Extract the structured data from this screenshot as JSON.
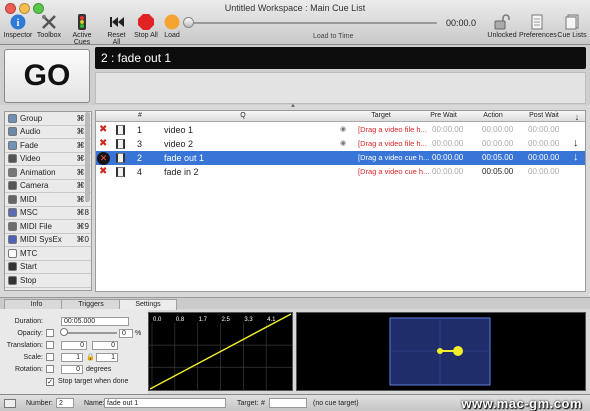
{
  "window": {
    "title": "Untitled Workspace : Main Cue List",
    "controls": [
      {
        "name": "close",
        "color": "#ee5d52"
      },
      {
        "name": "minimize",
        "color": "#f5be4f"
      },
      {
        "name": "zoom",
        "color": "#59c849"
      }
    ]
  },
  "toolbar": {
    "inspector": "Inspector",
    "toolbox": "Toolbox",
    "active_cues": "Active Cues",
    "reset_all": "Reset All",
    "stop_all": "Stop All",
    "load": "Load",
    "time": "00:00.0",
    "load_to_time": "Load to Time",
    "unlocked": "Unlocked",
    "preferences": "Preferences",
    "cue_lists": "Cue Lists"
  },
  "go": {
    "label": "GO"
  },
  "current_cue": "2 : fade out 1",
  "sidebar": {
    "items": [
      {
        "label": "Group",
        "shortcut": "⌘1",
        "icon": "group-icon",
        "color": "#6f8fb8"
      },
      {
        "label": "Audio",
        "shortcut": "⌘2",
        "icon": "audio-icon",
        "color": "#6d88a8"
      },
      {
        "label": "Fade",
        "shortcut": "⌘3",
        "icon": "fade-icon",
        "color": "#7092b9"
      },
      {
        "label": "Video",
        "shortcut": "⌘4",
        "icon": "video-icon",
        "color": "#555555"
      },
      {
        "label": "Animation",
        "shortcut": "⌘5",
        "icon": "animation-icon",
        "color": "#777777"
      },
      {
        "label": "Camera",
        "shortcut": "⌘6",
        "icon": "camera-icon",
        "color": "#555555"
      },
      {
        "label": "MIDI",
        "shortcut": "⌘7",
        "icon": "midi-icon",
        "color": "#666666"
      },
      {
        "label": "MSC",
        "shortcut": "⌘8",
        "icon": "msc-icon",
        "color": "#5b6bb0"
      },
      {
        "label": "MIDI File",
        "shortcut": "⌘9",
        "icon": "midi-file-icon",
        "color": "#6e6e6e"
      },
      {
        "label": "MIDI SysEx",
        "shortcut": "⌘0",
        "icon": "midi-sysex-icon",
        "color": "#4f63b5"
      },
      {
        "label": "MTC",
        "shortcut": "",
        "icon": "mtc-icon",
        "color": "#ffffff"
      },
      {
        "label": "Start",
        "shortcut": "",
        "icon": "start-icon",
        "color": "#333333"
      },
      {
        "label": "Stop",
        "shortcut": "",
        "icon": "stop-icon",
        "color": "#333333"
      }
    ]
  },
  "table": {
    "headers": {
      "num": "#",
      "q": "Q",
      "target": "Target",
      "pre_wait": "Pre Wait",
      "action": "Action",
      "post_wait": "Post Wait"
    },
    "rows": [
      {
        "num": "1",
        "q": "video 1",
        "target": "[Drag a video file h...",
        "pre_wait": "00:00.00",
        "action": "00:00.00",
        "post_wait": "00:00.00",
        "selected": false,
        "arrow": ""
      },
      {
        "num": "3",
        "q": "video 2",
        "target": "[Drag a video file h...",
        "pre_wait": "00:00.00",
        "action": "00:00.00",
        "post_wait": "00:00.00",
        "selected": false,
        "arrow": "↓"
      },
      {
        "num": "2",
        "q": "fade out 1",
        "target": "[Drag a video cue h...",
        "pre_wait": "00:00.00",
        "action": "00:05.00",
        "post_wait": "00:00.00",
        "selected": true,
        "arrow": "↓"
      },
      {
        "num": "4",
        "q": "fade in 2",
        "target": "[Drag a video cue h...",
        "pre_wait": "00:00.00",
        "action": "00:05.00",
        "post_wait": "00:00.00",
        "selected": false,
        "arrow": ""
      }
    ]
  },
  "tabs": {
    "info": "Info",
    "triggers": "Triggers",
    "settings": "Settings"
  },
  "settings": {
    "duration_label": "Duration:",
    "duration": "00:05.000",
    "opacity_label": "Opacity:",
    "opacity": "0",
    "percent": "%",
    "translation_label": "Translation:",
    "translation_x": "0",
    "translation_y": "0",
    "scale_label": "Scale:",
    "scale_x": "1",
    "scale_y": "1",
    "rotation_label": "Rotation:",
    "rotation": "0",
    "degrees": "degrees",
    "stop_target": "Stop target when done",
    "stop_target_checked": true
  },
  "fade_curve": {
    "ticks": [
      "0.0",
      "0.8",
      "1.7",
      "2.5",
      "3.3",
      "4.1"
    ]
  },
  "statusbar": {
    "number_label": "Number:",
    "number": "2",
    "name_label": "Name:",
    "name": "fade out 1",
    "target_label": "Target:",
    "target_hash": "#",
    "no_target": "(no cue target)"
  },
  "watermark": "www.mac-gm.com",
  "colors": {
    "selection": "#3875d7",
    "target_text": "#d8272a",
    "curve": "#f3ee28",
    "preview_box": "#1f2d6b"
  }
}
